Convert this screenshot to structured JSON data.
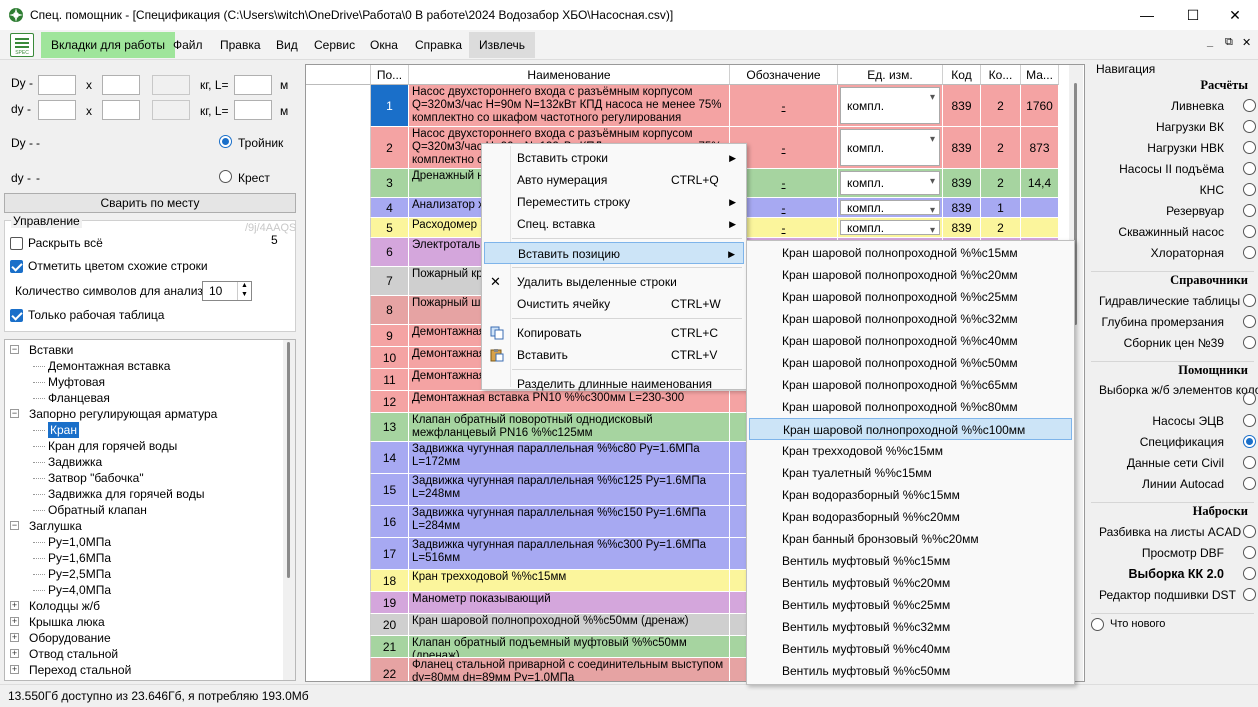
{
  "window": {
    "title": "Спец. помощник - [Спецификация (C:\\Users\\witch\\OneDrive\\Работа\\0 В работе\\2024 Водозабор ХБО\\Насосная.csv)]",
    "minimize": "—",
    "maximize": "☐",
    "close": "✕"
  },
  "menubar": {
    "items": [
      "Вкладки для работы",
      "Файл",
      "Правка",
      "Вид",
      "Сервис",
      "Окна",
      "Справка",
      "Извлечь"
    ],
    "icon_caption": "SPEC",
    "mdi_min": "_",
    "mdi_restore": "⧉",
    "mdi_close": "✕"
  },
  "leftpane": {
    "dy1_label": "Dy -",
    "dy2_label": "dy -",
    "x_label": "x",
    "kg_label": "кг, L=",
    "m_label": "м",
    "Dy_label": "Dy -",
    "Dy_value": "-",
    "dy_label": "dy -",
    "dy_value": "-",
    "tee_label": "Тройник",
    "cross_label": "Крест",
    "weld_button": "Сварить по месту",
    "control_group": "Управление",
    "faded_text": "/9j/4AAQS",
    "count_value": "5",
    "expand_all": "Раскрыть всё",
    "mark_similar": "Отметить цветом схожие строки",
    "char_count_label": "Количество символов для анализа",
    "char_count_value": "10",
    "only_work_table": "Только рабочая таблица"
  },
  "tree": {
    "nodes": [
      {
        "label": "Вставки",
        "level": 0,
        "exp": "−"
      },
      {
        "label": "Демонтажная вставка",
        "level": 2
      },
      {
        "label": "Муфтовая",
        "level": 2
      },
      {
        "label": "Фланцевая",
        "level": 2
      },
      {
        "label": "Запорно регулирующая арматура",
        "level": 0,
        "exp": "−"
      },
      {
        "label": "Кран",
        "level": 2,
        "selected": true
      },
      {
        "label": "Кран для горячей воды",
        "level": 2
      },
      {
        "label": "Задвижка",
        "level": 2
      },
      {
        "label": "Затвор \"бабочка\"",
        "level": 2
      },
      {
        "label": "Задвижка для горячей воды",
        "level": 2
      },
      {
        "label": "Обратный клапан",
        "level": 2
      },
      {
        "label": "Заглушка",
        "level": 0,
        "exp": "−"
      },
      {
        "label": "Ру=1,0МПа",
        "level": 2
      },
      {
        "label": "Ру=1,6МПа",
        "level": 2
      },
      {
        "label": "Ру=2,5МПа",
        "level": 2
      },
      {
        "label": "Ру=4,0МПа",
        "level": 2
      },
      {
        "label": "Колодцы ж/б",
        "level": 0,
        "exp": "+"
      },
      {
        "label": "Крышка люка",
        "level": 0,
        "exp": "+"
      },
      {
        "label": "Оборудование",
        "level": 0,
        "exp": "+"
      },
      {
        "label": "Отвод стальной",
        "level": 0,
        "exp": "+"
      },
      {
        "label": "Переход стальной",
        "level": 0,
        "exp": "+"
      }
    ]
  },
  "grid": {
    "columns": [
      "По...",
      "Наименование",
      "Обозначение",
      "Ед. изм.",
      "Код",
      "Ко...",
      "Ма..."
    ],
    "rowheader_value": "1",
    "rows": [
      {
        "n": "1",
        "name": "Насос двухстороннего входа с разъёмным корпусом Q=320м3/час H=90м N=132кВт КПД насоса не менее 75% комплектно со шкафом частотного регулирования",
        "desig": "-",
        "unit": "компл.",
        "code": "839",
        "qty": "2",
        "mass": "1760",
        "color": "#f4a3a3",
        "ncolor": "#1a6fc9",
        "h": 42
      },
      {
        "n": "2",
        "name": "Насос двухстороннего входа с разъёмным корпусом Q=320м3/час H=90м N=132кВт КПД насоса не менее 75% комплектно со шкафом частотного регулирования",
        "desig": "-",
        "unit": "компл.",
        "code": "839",
        "qty": "2",
        "mass": "873",
        "color": "#f4a3a3",
        "h": 42
      },
      {
        "n": "3",
        "name": "Дренажный насос с поплавковым выключателем",
        "desig": "-",
        "unit": "компл.",
        "code": "839",
        "qty": "2",
        "mass": "14,4",
        "color": "#a6d4a0",
        "h": 29
      },
      {
        "n": "4",
        "name": "Анализатор хлора",
        "desig": "-",
        "unit": "компл.",
        "code": "839",
        "qty": "1",
        "mass": "",
        "color": "#a7a9f2",
        "h": 20
      },
      {
        "n": "5",
        "name": "Расходомер ЭМИС",
        "desig": "-",
        "unit": "компл.",
        "code": "839",
        "qty": "2",
        "mass": "",
        "color": "#fbf59c",
        "h": 20
      },
      {
        "n": "6",
        "name": "Электроталь подъема - ЭкВ",
        "desig": "",
        "unit": "",
        "code": "",
        "qty": "",
        "mass": "",
        "color": "#d4a6dc",
        "h": 29
      },
      {
        "n": "7",
        "name": "Пожарный кран L=20м и наконечник",
        "desig": "",
        "unit": "",
        "code": "",
        "qty": "",
        "mass": "",
        "color": "#cfcfcf",
        "h": 29
      },
      {
        "n": "8",
        "name": "Пожарный шкаф пожарного крана",
        "desig": "",
        "unit": "",
        "code": "",
        "qty": "",
        "mass": "",
        "color": "#e6a3a3",
        "h": 29
      },
      {
        "n": "9",
        "name": "Демонтажная вставка",
        "desig": "",
        "unit": "",
        "code": "",
        "qty": "",
        "mass": "",
        "color": "#f4a3a3",
        "h": 22
      },
      {
        "n": "10",
        "name": "Демонтажная вставка",
        "desig": "",
        "unit": "",
        "code": "",
        "qty": "",
        "mass": "",
        "color": "#f4a3a3",
        "h": 22
      },
      {
        "n": "11",
        "name": "Демонтажная вставка",
        "desig": "",
        "unit": "",
        "code": "",
        "qty": "",
        "mass": "",
        "color": "#f4a3a3",
        "h": 22
      },
      {
        "n": "12",
        "name": "Демонтажная вставка PN10 %%с300мм L=230-300",
        "desig": "",
        "unit": "",
        "code": "",
        "qty": "",
        "mass": "",
        "color": "#f4a3a3",
        "h": 22
      },
      {
        "n": "13",
        "name": "Клапан обратный поворотный однодисковый межфланцевый PN16 %%с125мм",
        "desig": "",
        "unit": "",
        "code": "",
        "qty": "",
        "mass": "",
        "color": "#a6d4a0",
        "h": 29
      },
      {
        "n": "14",
        "name": "Задвижка чугунная параллельная %%с80 Ру=1.6МПа L=172мм",
        "desig": "",
        "unit": "",
        "code": "",
        "qty": "",
        "mass": "",
        "color": "#a7a9f2",
        "h": 32
      },
      {
        "n": "15",
        "name": "Задвижка чугунная параллельная %%с125 Ру=1.6МПа L=248мм",
        "desig": "",
        "unit": "",
        "code": "",
        "qty": "",
        "mass": "",
        "color": "#a7a9f2",
        "h": 32
      },
      {
        "n": "16",
        "name": "Задвижка чугунная параллельная %%с150 Ру=1.6МПа L=284мм",
        "desig": "",
        "unit": "",
        "code": "",
        "qty": "",
        "mass": "",
        "color": "#a7a9f2",
        "h": 32
      },
      {
        "n": "17",
        "name": "Задвижка чугунная параллельная %%с300 Ру=1.6МПа L=516мм",
        "desig": "",
        "unit": "",
        "code": "",
        "qty": "",
        "mass": "",
        "color": "#a7a9f2",
        "h": 32
      },
      {
        "n": "18",
        "name": "Кран трехходовой %%с15мм",
        "desig": "",
        "unit": "",
        "code": "",
        "qty": "",
        "mass": "",
        "color": "#fbf59c",
        "h": 22
      },
      {
        "n": "19",
        "name": "Манометр показывающий",
        "desig": "",
        "unit": "",
        "code": "",
        "qty": "",
        "mass": "",
        "color": "#d4a6dc",
        "h": 22
      },
      {
        "n": "20",
        "name": "Кран шаровой полнопроходной %%с50мм (дренаж)",
        "desig": "",
        "unit": "",
        "code": "",
        "qty": "",
        "mass": "",
        "color": "#cfcfcf",
        "h": 22
      },
      {
        "n": "21",
        "name": "Клапан обратный подъемный муфтовый %%с50мм (дренаж)",
        "desig": "",
        "unit": "",
        "code": "",
        "qty": "",
        "mass": "",
        "color": "#a6d4a0",
        "h": 22
      },
      {
        "n": "22",
        "name": "Фланец стальной приварной с соединительным выступом dy=80мм dн=89мм Ру=1,0МПа",
        "desig": "",
        "unit": "",
        "code": "",
        "qty": "",
        "mass": "",
        "color": "#e6a3a3",
        "h": 32
      }
    ]
  },
  "context_menu": {
    "items": [
      {
        "label": "Вставить строки",
        "shortcut": "",
        "arrow": "▶"
      },
      {
        "label": "Авто нумерация",
        "shortcut": "CTRL+Q",
        "arrow": ""
      },
      {
        "label": "Переместить строку",
        "shortcut": "",
        "arrow": "▶"
      },
      {
        "label": "Спец. вставка",
        "shortcut": "",
        "arrow": "▶"
      },
      {
        "sep": true
      },
      {
        "label": "Вставить позицию",
        "shortcut": "",
        "arrow": "▶",
        "hl": true
      },
      {
        "sep": true
      },
      {
        "label": "Удалить выделенные строки",
        "shortcut": "",
        "arrow": "",
        "icon": "✕"
      },
      {
        "label": "Очистить ячейку",
        "shortcut": "CTRL+W",
        "arrow": ""
      },
      {
        "sep": true
      },
      {
        "label": "Копировать",
        "shortcut": "CTRL+C",
        "arrow": "",
        "icon": "copy"
      },
      {
        "label": "Вставить",
        "shortcut": "CTRL+V",
        "arrow": "",
        "icon": "paste"
      },
      {
        "sep": true
      },
      {
        "label": "Разделить длинные наименования",
        "shortcut": "",
        "arrow": ""
      }
    ]
  },
  "submenu": {
    "items": [
      "Кран шаровой полнопроходной %%с15мм",
      "Кран шаровой полнопроходной %%с20мм",
      "Кран шаровой полнопроходной %%с25мм",
      "Кран шаровой полнопроходной %%с32мм",
      "Кран шаровой полнопроходной %%с40мм",
      "Кран шаровой полнопроходной %%с50мм",
      "Кран шаровой полнопроходной %%с65мм",
      "Кран шаровой полнопроходной %%с80мм",
      "Кран шаровой полнопроходной %%с100мм",
      "Кран трехходовой %%с15мм",
      "Кран туалетный %%с15мм",
      "Кран водоразборный %%с15мм",
      "Кран водоразборный %%с20мм",
      "Кран банный бронзовый %%с20мм",
      "Вентиль муфтовый %%с15мм",
      "Вентиль муфтовый %%с20мм",
      "Вентиль муфтовый %%с25мм",
      "Вентиль муфтовый %%с32мм",
      "Вентиль муфтовый %%с40мм",
      "Вентиль муфтовый %%с50мм"
    ],
    "highlight_index": 8
  },
  "navigation": {
    "title": "Навигация",
    "groups": [
      {
        "header": "Расчёты",
        "items": [
          "Ливневка",
          "Нагрузки ВК",
          "Нагрузки НВК",
          "Насосы II подъёма",
          "КНС",
          "Резервуар",
          "Скважинный насос",
          "Хлораторная"
        ]
      },
      {
        "header": "Справочники",
        "items": [
          "Гидравлические таблицы",
          "Глубина промерзания",
          "Сборник цен №39"
        ]
      },
      {
        "header": "Помощники",
        "items": [
          "Выборка ж/б элементов колодцев",
          "Насосы ЭЦВ",
          "Спецификация",
          "Данные сети Civil",
          "Линии Autocad"
        ]
      },
      {
        "header": "Наброски",
        "items": [
          "Разбивка на листы ACAD",
          "Просмотр DBF",
          "Выборка КК 2.0",
          "Редактор подшивки DST"
        ]
      }
    ],
    "selected": "Спецификация",
    "bold_item": "Выборка КК 2.0",
    "whats_new": "Что нового"
  },
  "status": {
    "text": "13.550Гб доступно из 23.646Гб, я потребляю 193.0Мб"
  },
  "colors": {
    "accent": "#1a6fc9",
    "tab_green": "#9fe59b"
  }
}
